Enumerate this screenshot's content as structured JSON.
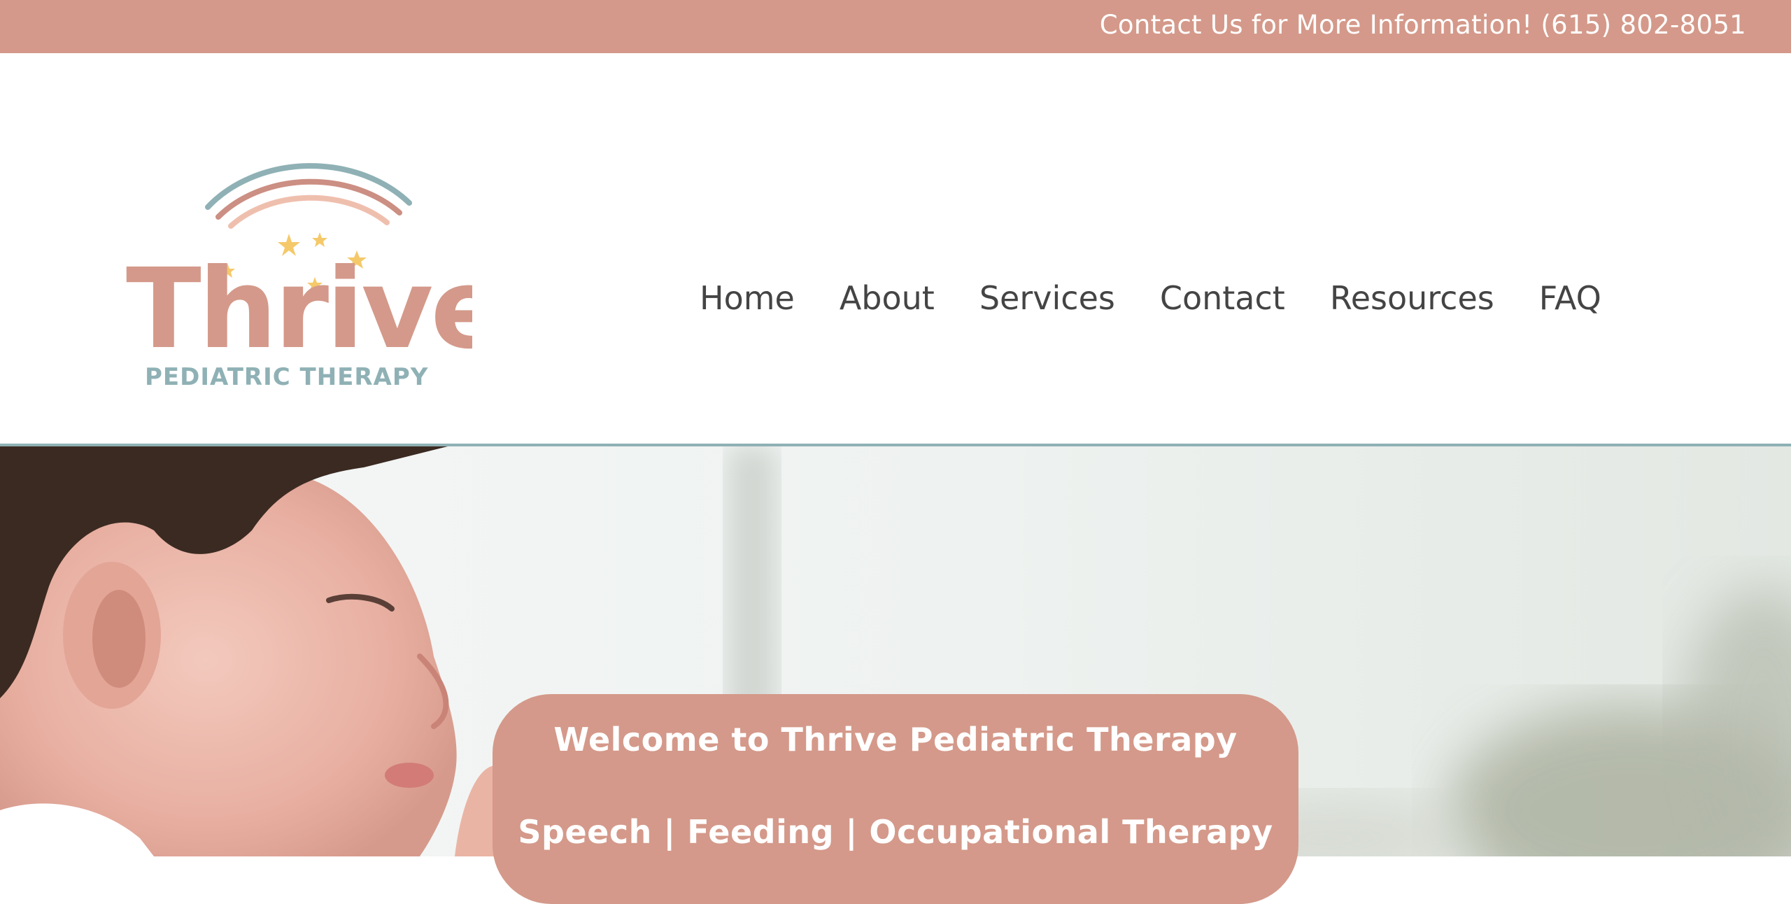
{
  "topbar": {
    "contact_text": "Contact Us for More Information! (615) 802-8051"
  },
  "logo": {
    "wordmark": "Thrive",
    "tagline": "PEDIATRIC THERAPY"
  },
  "nav": {
    "items": [
      {
        "label": "Home"
      },
      {
        "label": "About"
      },
      {
        "label": "Services"
      },
      {
        "label": "Contact"
      },
      {
        "label": "Resources"
      },
      {
        "label": "FAQ"
      }
    ]
  },
  "hero": {
    "welcome_title": "Welcome to Thrive Pediatric Therapy",
    "welcome_subtitle": "Speech | Feeding | Occupational Therapy"
  },
  "colors": {
    "brand_pink": "#d4998a",
    "brand_teal": "#8fb1b5",
    "star_yellow": "#f5c96a",
    "nav_text": "#444444"
  }
}
